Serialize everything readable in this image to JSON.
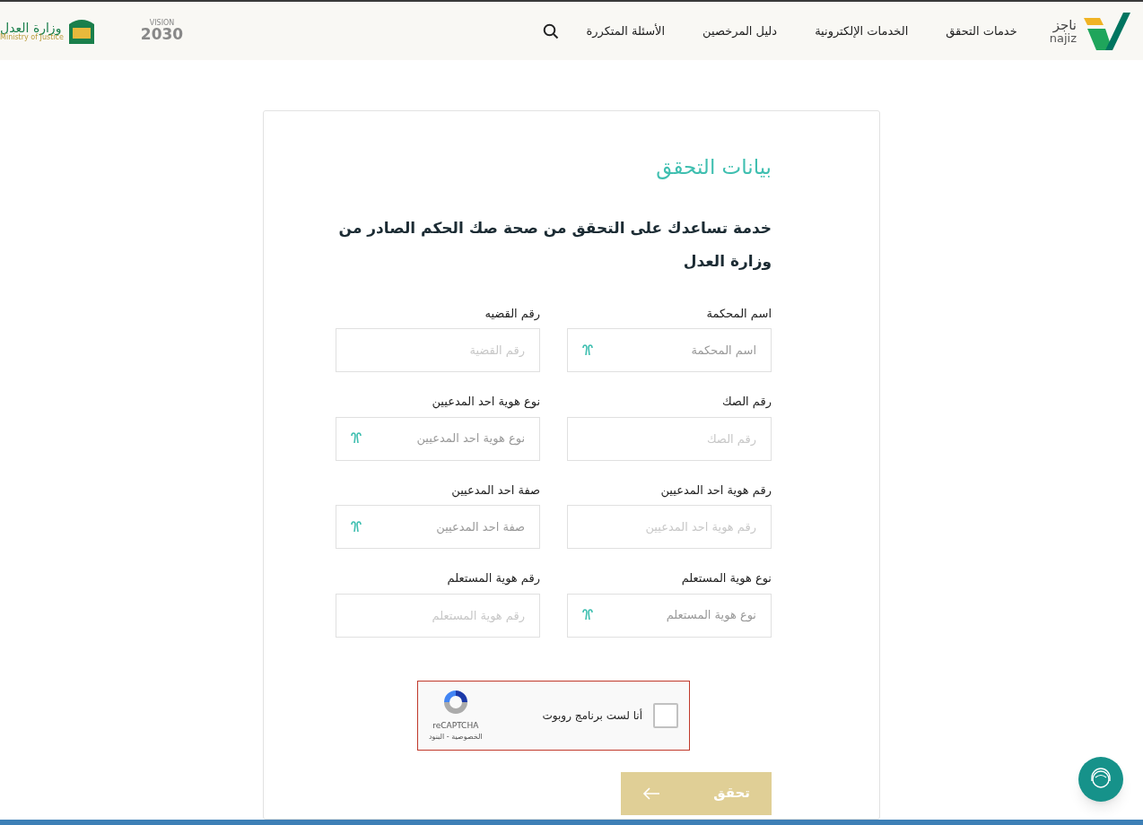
{
  "header": {
    "logo": {
      "arabic": "ناجز",
      "latin": "najiz"
    },
    "nav": [
      {
        "label": "خدمات التحقق"
      },
      {
        "label": "الخدمات الإلكترونية"
      },
      {
        "label": "دليل المرخصين"
      },
      {
        "label": "الأسئلة المتكررة"
      }
    ],
    "vision": {
      "word": "VISION",
      "year": "2030"
    },
    "ministry": {
      "arabic": "وزارة العدل",
      "latin": "Ministry of Justice"
    }
  },
  "form": {
    "title": "بيانات التحقق",
    "description": "خدمة تساعدك على التحقق من صحة صك الحكم الصادر من وزارة العدل",
    "fields": [
      {
        "label": "اسم المحكمة",
        "placeholder": "اسم المحكمة",
        "kind": "select"
      },
      {
        "label": "رقم القضيه",
        "placeholder": "رقم القضية",
        "kind": "text"
      },
      {
        "label": "رقم الصك",
        "placeholder": "رقم الصك",
        "kind": "text"
      },
      {
        "label": "نوع هوية احد المدعيين",
        "placeholder": "نوع هوية احد المدعيين",
        "kind": "select"
      },
      {
        "label": "رقم هوية احد المدعيين",
        "placeholder": "رقم هوية احد المدعيين",
        "kind": "text"
      },
      {
        "label": "صفة احد المدعيين",
        "placeholder": "صفة احد المدعيين",
        "kind": "select"
      },
      {
        "label": "نوع هوية المستعلم",
        "placeholder": "نوع هوية المستعلم",
        "kind": "select"
      },
      {
        "label": "رقم هوية المستعلم",
        "placeholder": "رقم هوية المستعلم",
        "kind": "text"
      }
    ],
    "captcha": {
      "label": "أنا لست برنامج روبوت",
      "checked": false,
      "brand": "reCAPTCHA",
      "links": "الخصوصية - البنود"
    },
    "submit": "تحقق"
  }
}
